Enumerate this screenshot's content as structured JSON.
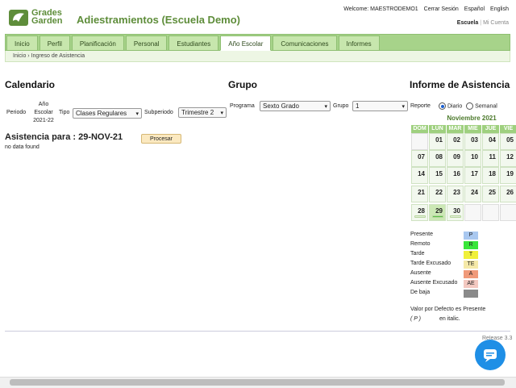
{
  "header": {
    "logo_line1": "Grades",
    "logo_line2": "Garden",
    "school_title": "Adiestramientos (Escuela Demo)",
    "welcome": "Welcome: MAESTRODEMO1",
    "logout": "Cerrar Sesión",
    "lang_es": "Español",
    "lang_en": "English",
    "school_link": "Escuela",
    "account_link": "Mi Cuenta"
  },
  "nav": {
    "tabs": [
      "Inicio",
      "Perfil",
      "Planificación",
      "Personal",
      "Estudiantes",
      "Año Escolar",
      "Comunicaciones",
      "Informes"
    ],
    "active_tab": "Año Escolar"
  },
  "breadcrumb": {
    "home": "Inicio",
    "sep": "›",
    "current": "Ingreso de Asistencia"
  },
  "calendario": {
    "title": "Calendario",
    "periodo_label": "Periodo",
    "periodo_value_1": "Año",
    "periodo_value_2": "Escolar",
    "periodo_value_3": "2021-22",
    "tipo_label": "Tipo",
    "tipo_value": "Clases Regulares",
    "subperiodo_label": "Subperiodo",
    "subperiodo_value": "Trimestre 2"
  },
  "grupo": {
    "title": "Grupo",
    "programa_label": "Programa",
    "programa_value": "Sexto Grado",
    "grupo_label": "Grupo",
    "grupo_value": "1"
  },
  "asistencia": {
    "heading": "Asistencia para : 29-NOV-21",
    "process_button": "Procesar",
    "empty_text": "no data found"
  },
  "informe": {
    "title": "Informe de Asistencia",
    "reporte_label": "Reporte",
    "opt_diario": "Diario",
    "opt_semanal": "Semanal",
    "selected": "Diario",
    "month": "Noviembre 2021",
    "dow": [
      "DOM",
      "LUN",
      "MAR",
      "MIE",
      "JUE",
      "VIE"
    ],
    "weeks": [
      [
        "",
        "01",
        "02",
        "03",
        "04",
        "05"
      ],
      [
        "07",
        "08",
        "09",
        "10",
        "11",
        "12"
      ],
      [
        "14",
        "15",
        "16",
        "17",
        "18",
        "19"
      ],
      [
        "21",
        "22",
        "23",
        "24",
        "25",
        "26"
      ],
      [
        "28",
        "29",
        "30",
        "",
        "",
        ""
      ]
    ],
    "today": "29"
  },
  "legend": [
    {
      "label": "Presente",
      "code": "P",
      "color": "#a9c8f0"
    },
    {
      "label": "Remoto",
      "code": "R",
      "color": "#39e639"
    },
    {
      "label": "Tarde",
      "code": "T",
      "color": "#f0f03a"
    },
    {
      "label": "Tarde Excusado",
      "code": "TE",
      "color": "#f5e9a8"
    },
    {
      "label": "Ausente",
      "code": "A",
      "color": "#f09a7a"
    },
    {
      "label": "Ausente Excusado",
      "code": "AE",
      "color": "#f3c8c0"
    },
    {
      "label": "De baja",
      "code": "",
      "color": "#8a8a8a"
    }
  ],
  "default_note_1": "Valor por Defecto es Presente",
  "default_note_2": "( P )",
  "default_note_3": "en italic.",
  "version": "Release 3.3"
}
